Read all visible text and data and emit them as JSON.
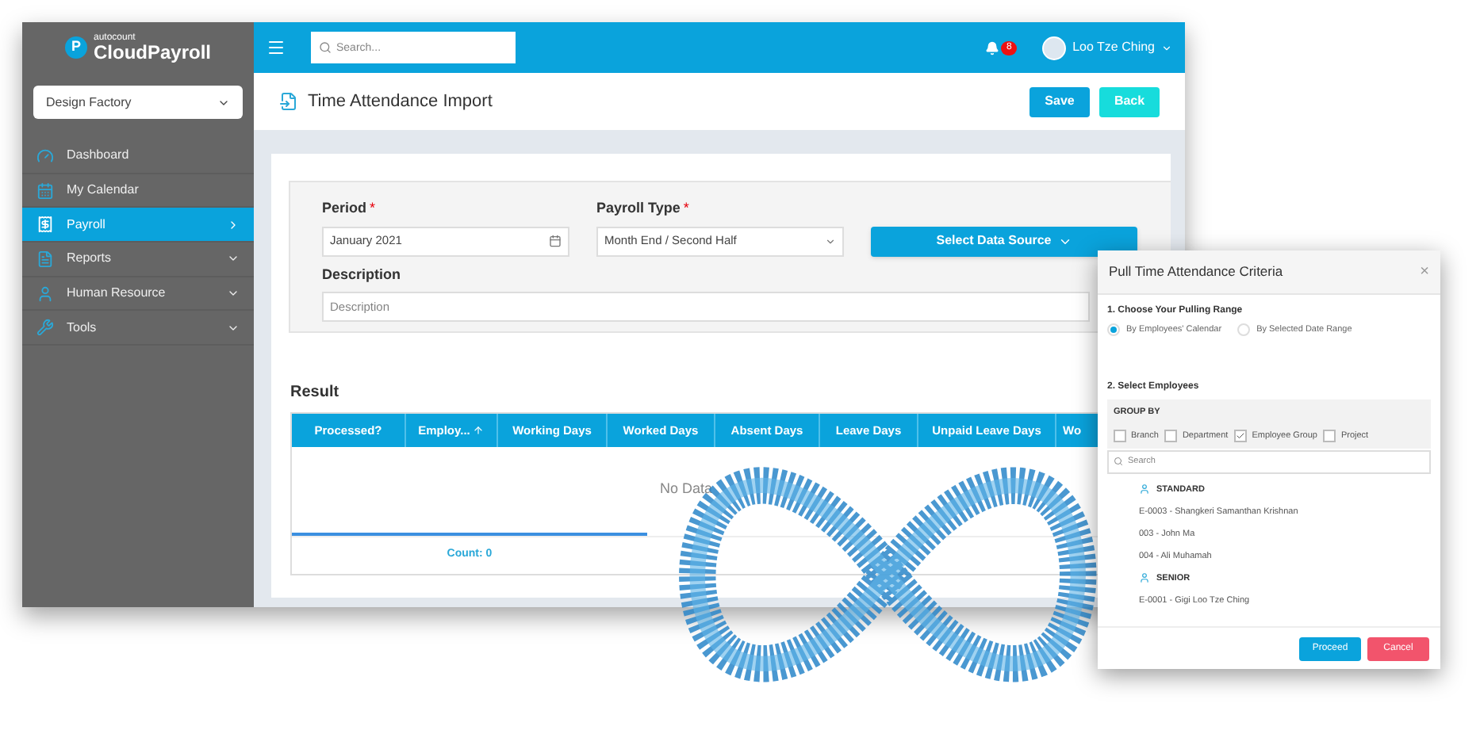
{
  "brand": {
    "small": "autocount",
    "name": "CloudPayroll",
    "letter": "P"
  },
  "company_select": {
    "value": "Design Factory"
  },
  "nav": [
    {
      "label": "Dashboard",
      "selected": false,
      "kind": "plain"
    },
    {
      "label": "My Calendar",
      "selected": false,
      "kind": "plain"
    },
    {
      "label": "Payroll",
      "selected": true,
      "kind": "submenu"
    },
    {
      "label": "Reports",
      "selected": false,
      "kind": "submenu"
    },
    {
      "label": "Human Resource",
      "selected": false,
      "kind": "submenu"
    },
    {
      "label": "Tools",
      "selected": false,
      "kind": "submenu"
    }
  ],
  "topbar": {
    "search": {
      "placeholder": "Search..."
    },
    "notifications": "8",
    "user": "Loo Tze Ching"
  },
  "page": {
    "title": "Time Attendance Import",
    "buttons": [
      {
        "label": "Save",
        "kind": "primary"
      },
      {
        "label": "Back",
        "kind": "secondary"
      }
    ]
  },
  "form": {
    "period": {
      "label": "Period",
      "required_mark": "*",
      "value": "January 2021"
    },
    "payroll_type": {
      "label": "Payroll Type",
      "required_mark": "*",
      "value": "Month End / Second Half"
    },
    "data_source_button": "Select Data Source",
    "description": {
      "label": "Description",
      "placeholder": "Description"
    }
  },
  "result": {
    "title": "Result",
    "columns": [
      {
        "label": "Processed?",
        "sorted": false
      },
      {
        "label": "Employ...",
        "sorted": true
      },
      {
        "label": "Working Days",
        "sorted": false
      },
      {
        "label": "Worked Days",
        "sorted": false
      },
      {
        "label": "Absent Days",
        "sorted": false
      },
      {
        "label": "Leave Days",
        "sorted": false
      },
      {
        "label": "Unpaid Leave Days",
        "sorted": false
      },
      {
        "label": "Wo",
        "sorted": false
      }
    ],
    "empty_text": "No Data",
    "count": "Count: 0"
  },
  "dialog": {
    "title": "Pull Time Attendance Criteria",
    "close": "×",
    "section_1": "1. Choose Your Pulling Range",
    "radios": [
      {
        "label": "By Employees' Calendar",
        "selected": true
      },
      {
        "label": "By Selected Date Range",
        "selected": false
      }
    ],
    "section_2": "2. Select Employees",
    "group_by": "GROUP BY",
    "checkboxes": [
      {
        "label": "Branch",
        "checked": false
      },
      {
        "label": "Department",
        "checked": false
      },
      {
        "label": "Employee Group",
        "checked": true
      },
      {
        "label": "Project",
        "checked": false
      }
    ],
    "search": {
      "placeholder": "Search"
    },
    "groups": [
      {
        "name": "STANDARD",
        "employees": [
          "E-0003 - Shangkeri Samanthan Krishnan",
          "003 - John Ma",
          "004 - Ali Muhamah"
        ]
      },
      {
        "name": "SENIOR",
        "employees": [
          "E-0001 - Gigi Loo Tze Ching"
        ]
      }
    ],
    "buttons": [
      {
        "label": "Proceed",
        "kind": "primary"
      },
      {
        "label": "Cancel",
        "kind": "danger"
      }
    ]
  }
}
